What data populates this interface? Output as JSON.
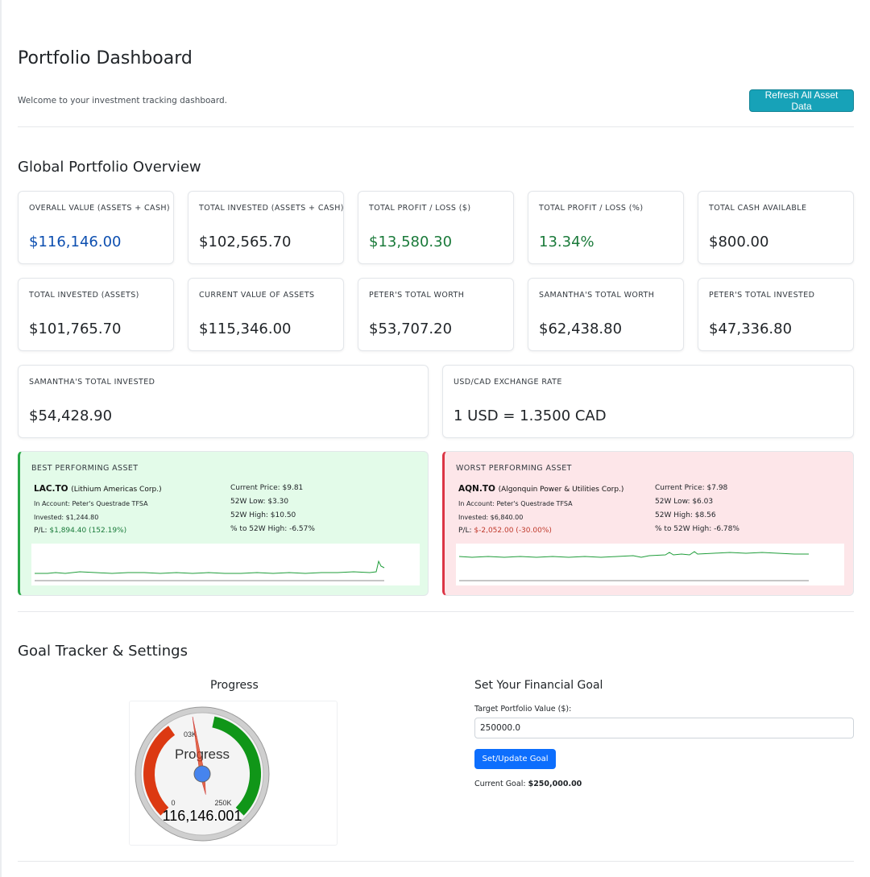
{
  "header": {
    "title": "Portfolio Dashboard",
    "welcome": "Welcome to your investment tracking dashboard.",
    "refresh_label": "Refresh All Asset Data"
  },
  "overview": {
    "title": "Global Portfolio Overview",
    "row1": [
      {
        "label": "Overall Value (Assets + Cash)",
        "value": "$116,146.00"
      },
      {
        "label": "Total Invested (Assets + Cash)",
        "value": "$102,565.70"
      },
      {
        "label": "Total Profit / Loss ($)",
        "value": "$13,580.30"
      },
      {
        "label": "Total Profit / Loss (%)",
        "value": "13.34%"
      },
      {
        "label": "Total Cash Available",
        "value": "$800.00"
      }
    ],
    "row2": [
      {
        "label": "Total Invested (Assets)",
        "value": "$101,765.70"
      },
      {
        "label": "Current Value of Assets",
        "value": "$115,346.00"
      },
      {
        "label": "Peter's Total Worth",
        "value": "$53,707.20"
      },
      {
        "label": "Samantha's Total Worth",
        "value": "$62,438.80"
      },
      {
        "label": "Peter's Total Invested",
        "value": "$47,336.80"
      }
    ],
    "row3": [
      {
        "label": "Samantha's Total Invested",
        "value": "$54,428.90"
      },
      {
        "label": "USD/CAD Exchange Rate",
        "value": "1 USD = 1.3500 CAD"
      }
    ],
    "colors": {
      "value_blue": "#0d4fb0",
      "value_green": "#1a7a3a"
    }
  },
  "best": {
    "title": "Best Performing Asset",
    "ticker": "LAC.TO",
    "company": "(Lithium Americas Corp.)",
    "account": "In Account: Peter's Questrade TFSA",
    "invested": "Invested: $1,244.80",
    "pl_label": "P/L:",
    "pl_value": "$1,894.40 (152.19%)",
    "current_price": "Current Price: $9.81",
    "low_52w": "52W Low: $3.30",
    "high_52w": "52W High: $10.50",
    "pct_to_high": "% to 52W High: -6.57%",
    "accent": "#28a745"
  },
  "worst": {
    "title": "Worst Performing Asset",
    "ticker": "AQN.TO",
    "company": "(Algonquin Power & Utilities Corp.)",
    "account": "In Account: Peter's Questrade TFSA",
    "invested": "Invested: $6,840.00",
    "pl_label": "P/L:",
    "pl_value": "$-2,052.00 (-30.00%)",
    "current_price": "Current Price: $7.98",
    "low_52w": "52W Low: $6.03",
    "high_52w": "52W High: $8.56",
    "pct_to_high": "% to 52W High: -6.78%",
    "accent": "#dc3545"
  },
  "goal": {
    "section_title": "Goal Tracker & Settings",
    "progress_title": "Progress",
    "gauge": {
      "label": "Progress",
      "value": 116146.001,
      "value_text": "116,146.001",
      "min": 0,
      "max": 250000,
      "min_label": "0",
      "max_label": "250K",
      "mid_label": "03K"
    },
    "form_title": "Set Your Financial Goal",
    "input_label": "Target Portfolio Value ($):",
    "input_value": "250000.0",
    "button_label": "Set/Update Goal",
    "current_label": "Current Goal:",
    "current_value": "$250,000.00"
  }
}
